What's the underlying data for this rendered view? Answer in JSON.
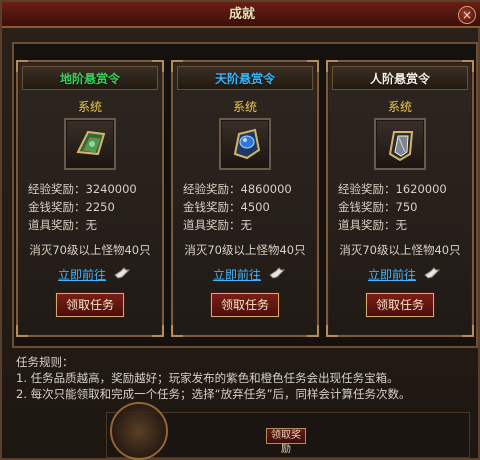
{
  "window": {
    "title": "成就"
  },
  "cards": [
    {
      "title": "地阶悬赏令",
      "title_color": "#3ad35a",
      "subtitle": "系统",
      "icon": "green-jade-token-icon",
      "exp_label": "经验奖励：",
      "exp_value": "3240000",
      "money_label": "金钱奖励：",
      "money_value": "2250",
      "item_label": "道具奖励：",
      "item_value": "无",
      "requirement": "消灭70级以上怪物40只",
      "go_label": "立即前往",
      "accept_label": "领取任务"
    },
    {
      "title": "天阶悬赏令",
      "title_color": "#35b8ff",
      "subtitle": "系统",
      "icon": "blue-sapphire-token-icon",
      "exp_label": "经验奖励：",
      "exp_value": "4860000",
      "money_label": "金钱奖励：",
      "money_value": "4500",
      "item_label": "道具奖励：",
      "item_value": "无",
      "requirement": "消灭70级以上怪物40只",
      "go_label": "立即前往",
      "accept_label": "领取任务"
    },
    {
      "title": "人阶悬赏令",
      "title_color": "#f4f0e6",
      "subtitle": "系统",
      "icon": "silver-shield-token-icon",
      "exp_label": "经验奖励：",
      "exp_value": "1620000",
      "money_label": "金钱奖励：",
      "money_value": "750",
      "item_label": "道具奖励：",
      "item_value": "无",
      "requirement": "消灭70级以上怪物40只",
      "go_label": "立即前往",
      "accept_label": "领取任务"
    }
  ],
  "rules": {
    "heading": "任务规则：",
    "items": [
      "1. 任务品质越高，奖励越好；玩家发布的紫色和橙色任务会出现任务宝箱。",
      "2. 每次只能领取和完成一个任务；选择“放弃任务”后，同样会计算任务次数。"
    ]
  },
  "background": {
    "claim_label": "领取奖励"
  },
  "colors": {
    "accent_red": "#7a1e17",
    "gold_text": "#e8c84a",
    "link_blue": "#3fb4ff"
  }
}
